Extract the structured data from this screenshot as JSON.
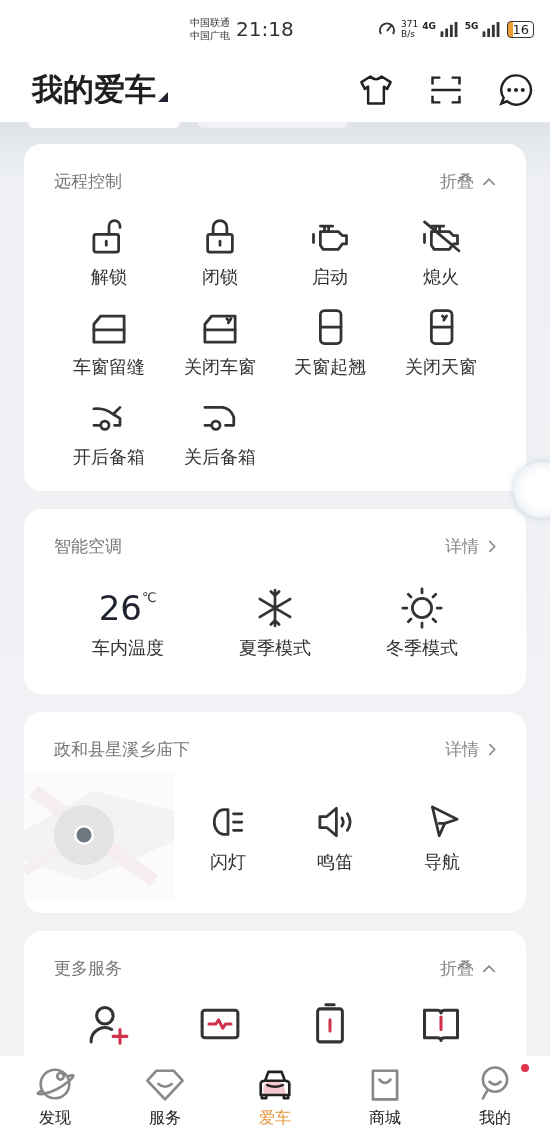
{
  "status_bar": {
    "carriers": [
      "中国联通",
      "中国广电"
    ],
    "time": "21:18",
    "speed": "371",
    "speed_unit": "B/s",
    "networks": [
      "4G",
      "5G"
    ],
    "battery": "16"
  },
  "header": {
    "title": "我的爱车"
  },
  "remote_control": {
    "title": "远程控制",
    "action": "折叠",
    "items": [
      {
        "kind": "unlock",
        "label": "解锁"
      },
      {
        "kind": "lock",
        "label": "闭锁"
      },
      {
        "kind": "engine",
        "label": "启动"
      },
      {
        "kind": "engine-off",
        "label": "熄火"
      },
      {
        "kind": "window",
        "label": "车窗留缝"
      },
      {
        "kind": "window-closed",
        "label": "关闭车窗"
      },
      {
        "kind": "sunroof",
        "label": "天窗起翘"
      },
      {
        "kind": "sunroof-closed",
        "label": "关闭天窗"
      },
      {
        "kind": "trunk-open",
        "label": "开后备箱"
      },
      {
        "kind": "trunk-closed",
        "label": "关后备箱"
      }
    ]
  },
  "air_conditioning": {
    "title": "智能空调",
    "action": "详情",
    "temperature": "26",
    "unit": "℃",
    "temperature_label": "车内温度",
    "items": [
      {
        "kind": "snowflake",
        "label": "夏季模式"
      },
      {
        "kind": "sun",
        "label": "冬季模式"
      }
    ]
  },
  "location": {
    "title": "政和县星溪乡庙下",
    "action": "详情",
    "items": [
      {
        "kind": "headlight",
        "label": "闪灯"
      },
      {
        "kind": "horn",
        "label": "鸣笛"
      },
      {
        "kind": "navigation",
        "label": "导航"
      }
    ]
  },
  "more_services": {
    "title": "更多服务",
    "action": "折叠",
    "items": [
      {
        "kind": "add-user"
      },
      {
        "kind": "monitor"
      },
      {
        "kind": "battery"
      },
      {
        "kind": "book"
      }
    ]
  },
  "tab_bar": {
    "tabs": [
      {
        "kind": "planet",
        "label": "发现",
        "selected": false,
        "dot": false
      },
      {
        "kind": "diamond",
        "label": "服务",
        "selected": false,
        "dot": false
      },
      {
        "kind": "car",
        "label": "爱车",
        "selected": true,
        "dot": false
      },
      {
        "kind": "bag",
        "label": "商城",
        "selected": false,
        "dot": false
      },
      {
        "kind": "face",
        "label": "我的",
        "selected": false,
        "dot": true
      }
    ]
  }
}
